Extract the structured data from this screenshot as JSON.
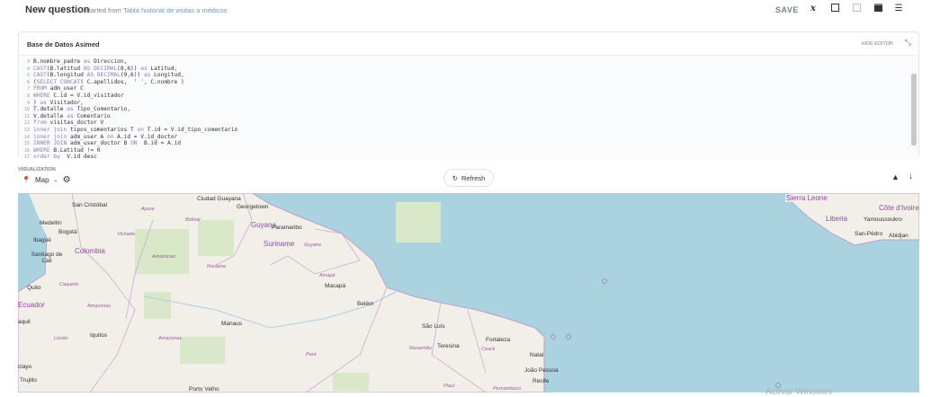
{
  "header": {
    "title": "New question",
    "started_prefix": "started from",
    "source_link": "Tabla historial de visitas a médicos",
    "save_label": "SAVE",
    "icons": [
      "variable-icon",
      "add-snippet-icon",
      "sql-snippets-icon",
      "data-reference-icon",
      "menu-icon"
    ]
  },
  "editor": {
    "database": "Base de Datos Asimed",
    "hide_label": "HIDE EDITOR",
    "lines": [
      {
        "n": "3",
        "t": "B.nombre_padre as Direccion,"
      },
      {
        "n": "4",
        "t": "CAST(B.latitud AS DECIMAL(8,6)) as Latitud,"
      },
      {
        "n": "5",
        "t": "CAST(B.longitud AS DECIMAL(9,6)) as Longitud,"
      },
      {
        "n": "6",
        "t": "(SELECT CONCAT( C.apellidos,  ' ', C.nombre )"
      },
      {
        "n": "7",
        "t": "FROM adm_user C"
      },
      {
        "n": "8",
        "t": "WHERE C.id = V.id_visitador"
      },
      {
        "n": "9",
        "t": ") as Visitador,"
      },
      {
        "n": "10",
        "t": "T.detalle as Tipo_Comentario,"
      },
      {
        "n": "11",
        "t": "V.detalle as Comentario"
      },
      {
        "n": "12",
        "t": "from visitas_doctor V"
      },
      {
        "n": "13",
        "t": "inner join tipos_comentarios T on T.id = V.id_tipo_comentario"
      },
      {
        "n": "14",
        "t": "inner join adm_user A on A.id = V.id_doctor"
      },
      {
        "n": "15",
        "t": "INNER JOIN adm_user_doctor B ON  B.id = A.id"
      },
      {
        "n": "16",
        "t": "WHERE B.Latitud != 0"
      },
      {
        "n": "17",
        "t": "order by  V.id desc"
      }
    ]
  },
  "visualization": {
    "label": "VISUALIZATION",
    "type": "Map",
    "refresh_label": "Refresh"
  },
  "map": {
    "cities": [
      "Ciudad Guayana",
      "San Cristóbal",
      "Georgetown",
      "Medellín",
      "Bogotá",
      "Ibagué",
      "Santiago de Cali",
      "Paramaribo",
      "Quito",
      "Macapá",
      "Belém",
      "Manaus",
      "Iquitos",
      "São Luís",
      "Teresina",
      "Fortaleza",
      "Natal",
      "João Pessoa",
      "Recife",
      "Porto Velho",
      "Trujillo",
      "aquil",
      "clayo",
      "Yamoussoukro",
      "San-Pédro",
      "Abidjan"
    ],
    "countries": [
      "Colombia",
      "Guyana",
      "Suriname",
      "Ecuador",
      "Sierra Leone",
      "Liberia",
      "Côte d'Ivoire"
    ],
    "regions": [
      "Apure",
      "Bolívar",
      "Vichada",
      "Amazonas",
      "Roraima",
      "Guyane",
      "Amapá",
      "Caquetá",
      "Amazonas",
      "Loreto",
      "Amazonas",
      "Pará",
      "Maranhão",
      "Ceará",
      "Piauí",
      "Pernambuco"
    ],
    "colors": {
      "ocean": "#aad3df",
      "land": "#f2efe9",
      "forest": "#d8e8c8",
      "border": "#c9a3d1"
    }
  },
  "watermark": "Activar Windows"
}
